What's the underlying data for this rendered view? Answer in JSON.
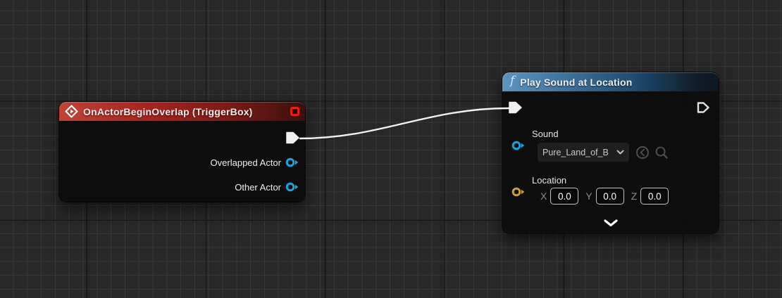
{
  "app": "unreal-blueprint-graph",
  "canvas": {
    "background": "#272727",
    "grid_minor": "#373737",
    "grid_major": "#151515"
  },
  "colors": {
    "exec": "#f0f0f0",
    "object_pin": "#16a3e4",
    "vector_pin": "#c9a12b",
    "delegate": "#f21b10",
    "wire": "#f2f2f2",
    "event_header": "#a8241d",
    "function_header": "#3c729c"
  },
  "icons": {
    "event": "diamond-arrow-icon",
    "delegate": "red-square-delegate-pin",
    "function": "italic-f-icon",
    "combo": "chevron-down-icon",
    "use_asset": "circle-arrow-left-icon",
    "browse": "magnifier-icon",
    "expand": "chevron-down-icon"
  },
  "nodes": {
    "event": {
      "title": "OnActorBeginOverlap (TriggerBox)",
      "output_pins": [
        {
          "label": "Overlapped Actor",
          "type": "object"
        },
        {
          "label": "Other Actor",
          "type": "object"
        }
      ]
    },
    "function": {
      "title": "Play Sound at Location",
      "glyph": "f",
      "sound": {
        "label": "Sound",
        "value": "Pure_Land_of_B"
      },
      "location": {
        "label": "Location",
        "axes": [
          {
            "label": "X",
            "value": "0.0"
          },
          {
            "label": "Y",
            "value": "0.0"
          },
          {
            "label": "Z",
            "value": "0.0"
          }
        ]
      }
    }
  },
  "connections": [
    {
      "from": "event.exec-out",
      "to": "function.exec-in",
      "type": "exec"
    }
  ]
}
